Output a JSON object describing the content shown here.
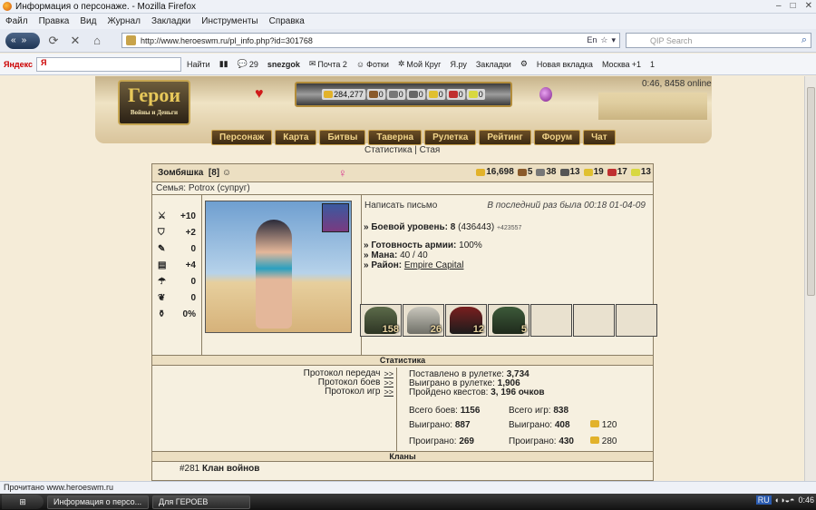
{
  "window": {
    "title": "Информация о персонаже. - Mozilla Firefox"
  },
  "menu": [
    "Файл",
    "Правка",
    "Вид",
    "Журнал",
    "Закладки",
    "Инструменты",
    "Справка"
  ],
  "nav": {
    "url": "http://www.heroeswm.ru/pl_info.php?id=301768",
    "search_placeholder": "QIP Search",
    "lang": "En"
  },
  "yabar": {
    "brand": "Яндекс",
    "input_value": "Я",
    "go": "Найти",
    "count1": "29",
    "user": "snezgok",
    "mail": "Почта 2",
    "photos": "Фотки",
    "circle": "Мой Круг",
    "yaru": "Я.ру",
    "bookmarks": "Закладки",
    "newtab": "Новая вкладка",
    "city": "Москва",
    "temp": "+1",
    "count2": "1"
  },
  "game": {
    "logo": "Герои",
    "logo_sub": "Войны и Деньги",
    "resources": [
      "284,277",
      "0",
      "0",
      "0",
      "0",
      "0",
      "0"
    ],
    "online": "0:46, 8458 online",
    "menu": [
      "Персонаж",
      "Карта",
      "Битвы",
      "Таверна",
      "Рулетка",
      "Рейтинг",
      "Форум",
      "Чат"
    ],
    "submenu": "Статистика | Стая"
  },
  "player": {
    "name": "Зомбяшка",
    "level": "[8]",
    "gold": "16,698",
    "res1": "5",
    "res2": "38",
    "res3": "13",
    "res4": "19",
    "res5": "17",
    "res6": "13",
    "family": "Семья: Potrox (супруг)",
    "attrs": [
      "+10",
      "+2",
      "0",
      "+4",
      "0",
      "0",
      "0%"
    ],
    "write": "Написать письмо",
    "last_seen": "В последний раз была 00:18 01-04-09",
    "combat_label": "» Боевой уровень:",
    "combat_level": "8",
    "combat_exp": "(436443)",
    "combat_next": "+423557",
    "army_label": "» Готовность армии:",
    "army_value": "100%",
    "mana_label": "» Мана:",
    "mana_value": "40 / 40",
    "district_label": "» Район:",
    "district_value": "Empire Capital",
    "army": [
      "158",
      "26",
      "12",
      "5",
      "",
      "",
      ""
    ]
  },
  "stats": {
    "header": "Статистика",
    "protocols": [
      {
        "label": "Протокол передач",
        "link": ">>"
      },
      {
        "label": "Протокол боев",
        "link": ">>"
      },
      {
        "label": "Протокол игр",
        "link": ">>"
      }
    ],
    "roulette_bet_label": "Поставлено в рулетке:",
    "roulette_bet": "3,734",
    "roulette_won_label": "Выиграно в рулетке:",
    "roulette_won": "1,906",
    "quests_label": "Пройдено квестов:",
    "quests": "3, 196 очков",
    "battles_label": "Всего боев:",
    "battles": "1156",
    "games_label": "Всего игр:",
    "games": "838",
    "won_label": "Выиграно:",
    "won": "887",
    "games_won_label": "Выиграно:",
    "games_won": "408",
    "gold_won": "120",
    "lost_label": "Проиграно:",
    "lost": "269",
    "games_lost_label": "Проиграно:",
    "games_lost": "430",
    "gold_lost": "280"
  },
  "clans": {
    "header": "Кланы",
    "clan_id": "#281",
    "clan_name": "Клан войнов"
  },
  "status": "Прочитано www.heroeswm.ru",
  "taskbar": {
    "start": "",
    "task1": "Информация о персо...",
    "task2": "Для ГЕРОЕВ",
    "lang": "RU",
    "time": "0:46"
  }
}
